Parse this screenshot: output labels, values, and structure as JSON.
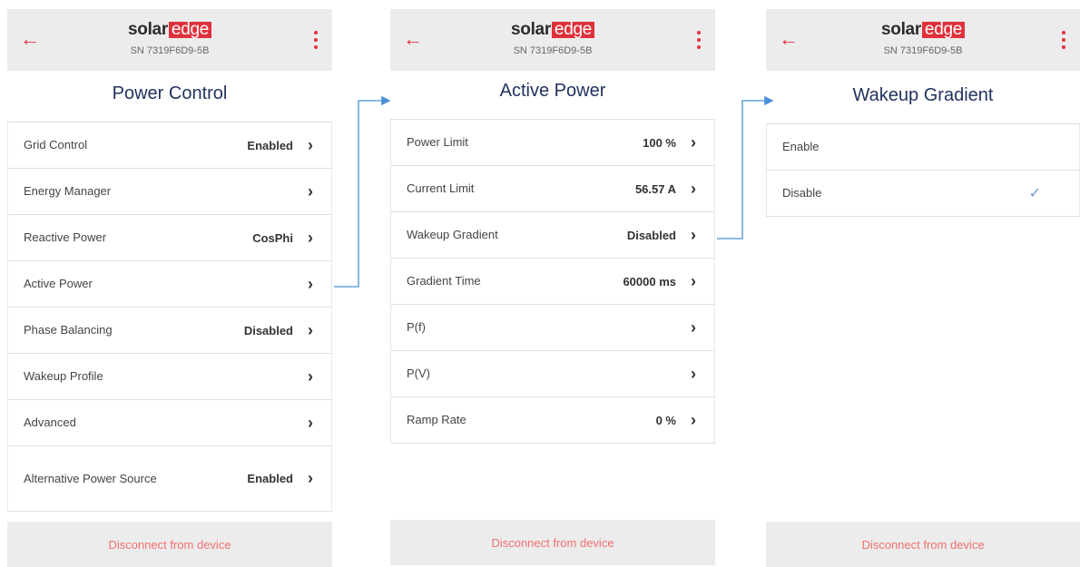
{
  "brand": {
    "solar": "solar",
    "edge": "edge"
  },
  "serial": "SN 7319F6D9-5B",
  "footer_label": "Disconnect from device",
  "screens": [
    {
      "title": "Power Control",
      "rows": [
        {
          "label": "Grid Control",
          "value": "Enabled"
        },
        {
          "label": "Energy Manager",
          "value": ""
        },
        {
          "label": "Reactive Power",
          "value": "CosPhi"
        },
        {
          "label": "Active Power",
          "value": ""
        },
        {
          "label": "Phase Balancing",
          "value": "Disabled"
        },
        {
          "label": "Wakeup Profile",
          "value": ""
        },
        {
          "label": "Advanced",
          "value": ""
        },
        {
          "label": "Alternative Power Source",
          "value": "Enabled"
        }
      ]
    },
    {
      "title": "Active Power",
      "rows": [
        {
          "label": "Power Limit",
          "value": "100 %"
        },
        {
          "label": "Current Limit",
          "value": "56.57 A"
        },
        {
          "label": "Wakeup Gradient",
          "value": "Disabled"
        },
        {
          "label": "Gradient Time",
          "value": "60000 ms"
        },
        {
          "label": "P(f)",
          "value": ""
        },
        {
          "label": "P(V)",
          "value": ""
        },
        {
          "label": "Ramp Rate",
          "value": "0 %"
        }
      ]
    },
    {
      "title": "Wakeup Gradient",
      "rows": [
        {
          "label": "Enable",
          "selected": false
        },
        {
          "label": "Disable",
          "selected": true
        }
      ]
    }
  ],
  "icons": {
    "back": "back-arrow-icon",
    "menu": "vertical-dots-icon",
    "chevron": "chevron-right-icon",
    "check": "checkmark-icon"
  },
  "colors": {
    "accent": "#e0303a",
    "title": "#21325e",
    "header_bg": "#ececec",
    "check": "#6a9ad8",
    "connector": "#4a90d9"
  }
}
